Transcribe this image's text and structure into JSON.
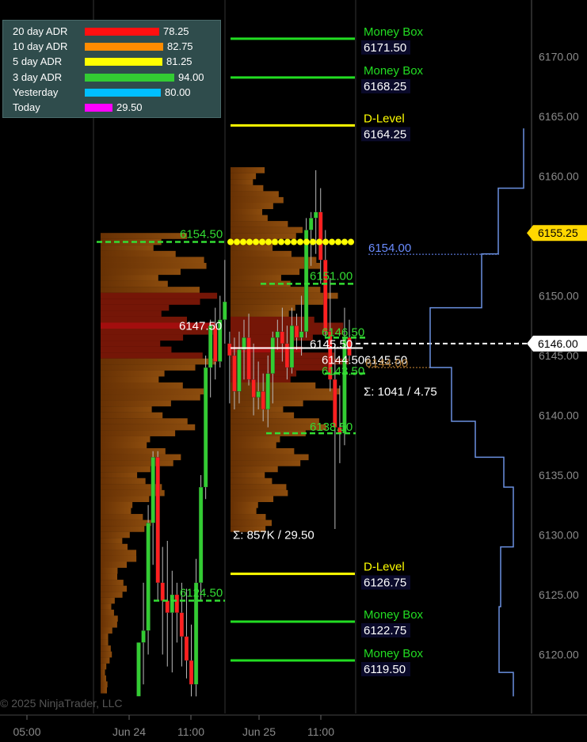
{
  "platform": {
    "copyright": "© 2025 NinjaTrader, LLC"
  },
  "adr_table": [
    {
      "label": "20 day ADR",
      "value": "78.25",
      "color": "#ff1010"
    },
    {
      "label": "10 day ADR",
      "value": "82.75",
      "color": "#ff8c00"
    },
    {
      "label": "5 day ADR",
      "value": "81.25",
      "color": "#ffff00"
    },
    {
      "label": "3 day ADR",
      "value": "94.00",
      "color": "#33cc33"
    },
    {
      "label": "Yesterday",
      "value": "80.00",
      "color": "#00bfff"
    },
    {
      "label": "Today",
      "value": "29.50",
      "color": "#ff00ff"
    }
  ],
  "chart_data": {
    "type": "candlestick",
    "y_axis": {
      "range": [
        6116.5,
        6175.0
      ],
      "ticks": [
        "6120.00",
        "6125.00",
        "6130.00",
        "6135.00",
        "6140.00",
        "6145.00",
        "6150.00",
        "6155.00",
        "6160.00",
        "6165.00",
        "6170.00"
      ]
    },
    "x_axis": {
      "ticks": [
        "05:00",
        "Jun 24",
        "11:00",
        "Jun 25",
        "11:00"
      ]
    },
    "current_price": {
      "label": "6155.25",
      "price": 6155.25,
      "color": "#ffd700"
    },
    "crosshair_price": {
      "label": "6146.00",
      "price": 6146.0
    },
    "levels": [
      {
        "name": "Money Box",
        "value": "6171.50",
        "price": 6171.5,
        "color": "#22dd22"
      },
      {
        "name": "Money Box",
        "value": "6168.25",
        "price": 6168.25,
        "color": "#22dd22"
      },
      {
        "name": "D-Level",
        "value": "6164.25",
        "price": 6164.25,
        "color": "#ffff00"
      },
      {
        "name": "D-Level",
        "value": "6126.75",
        "price": 6126.75,
        "color": "#ffff00"
      },
      {
        "name": "Money Box",
        "value": "6122.75",
        "price": 6122.75,
        "color": "#22dd22"
      },
      {
        "name": "Money Box",
        "value": "6119.50",
        "price": 6119.5,
        "color": "#22dd22"
      }
    ],
    "dashed_levels": [
      {
        "label": "6154.50",
        "price": 6154.5
      },
      {
        "label": "6151.00",
        "price": 6151.0
      },
      {
        "label": "6146.50",
        "price": 6146.5
      },
      {
        "label": "6143.50",
        "price": 6143.5
      },
      {
        "label": "6138.50",
        "price": 6138.5
      },
      {
        "label": "6124.50",
        "price": 6124.5
      }
    ],
    "annotations": [
      {
        "text": "6147.50",
        "price": 6147.5
      },
      {
        "text": "6145.50",
        "price": 6145.5
      },
      {
        "text": "6144.50",
        "price": 6144.5
      },
      {
        "text": "6145.50",
        "price": 6145.0
      },
      {
        "text": "6144.00",
        "price": 6144.25
      },
      {
        "text": "6154.00",
        "price": 6154.0
      },
      {
        "text": "Σ: 1041 / 4.75",
        "price": 6141.0
      },
      {
        "text": "Σ: 857K / 29.50",
        "price": 6130.0
      }
    ],
    "candles": [
      {
        "o": 6116.5,
        "h": 6121.0,
        "l": 6116.5,
        "c": 6121.0
      },
      {
        "o": 6121.0,
        "h": 6126.0,
        "l": 6117.5,
        "c": 6122.0
      },
      {
        "o": 6122.0,
        "h": 6132.5,
        "l": 6120.0,
        "c": 6131.0
      },
      {
        "o": 6131.0,
        "h": 6137.0,
        "l": 6127.5,
        "c": 6136.5
      },
      {
        "o": 6136.5,
        "h": 6137.0,
        "l": 6124.5,
        "c": 6126.0
      },
      {
        "o": 6126.0,
        "h": 6129.0,
        "l": 6120.0,
        "c": 6124.5
      },
      {
        "o": 6124.5,
        "h": 6129.5,
        "l": 6119.0,
        "c": 6123.5
      },
      {
        "o": 6123.5,
        "h": 6127.0,
        "l": 6118.5,
        "c": 6125.0
      },
      {
        "o": 6125.0,
        "h": 6126.0,
        "l": 6121.0,
        "c": 6123.5
      },
      {
        "o": 6123.5,
        "h": 6126.0,
        "l": 6119.0,
        "c": 6121.5
      },
      {
        "o": 6121.5,
        "h": 6125.5,
        "l": 6118.0,
        "c": 6119.5
      },
      {
        "o": 6119.5,
        "h": 6122.5,
        "l": 6116.5,
        "c": 6117.5
      },
      {
        "o": 6117.5,
        "h": 6128.0,
        "l": 6116.5,
        "c": 6126.0
      },
      {
        "o": 6126.0,
        "h": 6135.0,
        "l": 6124.5,
        "c": 6134.0
      },
      {
        "o": 6134.0,
        "h": 6145.0,
        "l": 6133.0,
        "c": 6144.0
      },
      {
        "o": 6144.0,
        "h": 6148.0,
        "l": 6141.5,
        "c": 6147.5
      },
      {
        "o": 6147.5,
        "h": 6149.0,
        "l": 6143.0,
        "c": 6144.5
      },
      {
        "o": 6144.5,
        "h": 6150.0,
        "l": 6144.0,
        "c": 6148.0
      },
      {
        "o": 6148.0,
        "h": 6153.0,
        "l": 6146.0,
        "c": 6149.5
      },
      {
        "o": 6146.0,
        "h": 6147.0,
        "l": 6141.0,
        "c": 6145.0
      },
      {
        "o": 6145.0,
        "h": 6146.5,
        "l": 6140.5,
        "c": 6142.0
      },
      {
        "o": 6142.0,
        "h": 6147.0,
        "l": 6141.0,
        "c": 6145.5
      },
      {
        "o": 6145.5,
        "h": 6148.0,
        "l": 6143.0,
        "c": 6146.5
      },
      {
        "o": 6146.5,
        "h": 6148.5,
        "l": 6142.5,
        "c": 6143.0
      },
      {
        "o": 6143.0,
        "h": 6146.0,
        "l": 6140.0,
        "c": 6141.5
      },
      {
        "o": 6141.5,
        "h": 6144.5,
        "l": 6140.5,
        "c": 6142.0
      },
      {
        "o": 6142.0,
        "h": 6143.5,
        "l": 6139.5,
        "c": 6140.5
      },
      {
        "o": 6140.5,
        "h": 6145.0,
        "l": 6139.0,
        "c": 6143.5
      },
      {
        "o": 6143.5,
        "h": 6147.0,
        "l": 6141.0,
        "c": 6146.5
      },
      {
        "o": 6146.5,
        "h": 6148.0,
        "l": 6145.5,
        "c": 6147.0
      },
      {
        "o": 6147.0,
        "h": 6149.0,
        "l": 6144.5,
        "c": 6146.0
      },
      {
        "o": 6146.0,
        "h": 6147.5,
        "l": 6143.0,
        "c": 6144.0
      },
      {
        "o": 6144.0,
        "h": 6149.0,
        "l": 6143.5,
        "c": 6147.5
      },
      {
        "o": 6147.5,
        "h": 6148.5,
        "l": 6145.5,
        "c": 6146.5
      },
      {
        "o": 6146.5,
        "h": 6150.0,
        "l": 6145.0,
        "c": 6147.0
      },
      {
        "o": 6147.0,
        "h": 6156.5,
        "l": 6146.5,
        "c": 6155.5
      },
      {
        "o": 6155.5,
        "h": 6157.0,
        "l": 6152.5,
        "c": 6156.5
      },
      {
        "o": 6156.5,
        "h": 6160.5,
        "l": 6153.5,
        "c": 6157.0
      },
      {
        "o": 6157.0,
        "h": 6159.0,
        "l": 6151.0,
        "c": 6153.0
      },
      {
        "o": 6153.0,
        "h": 6155.5,
        "l": 6146.5,
        "c": 6147.0
      },
      {
        "o": 6147.0,
        "h": 6151.5,
        "l": 6142.0,
        "c": 6143.0
      },
      {
        "o": 6143.0,
        "h": 6146.0,
        "l": 6130.5,
        "c": 6139.0
      },
      {
        "o": 6139.0,
        "h": 6142.5,
        "l": 6136.0,
        "c": 6138.5
      },
      {
        "o": 6138.5,
        "h": 6149.0,
        "l": 6137.5,
        "c": 6146.5
      },
      {
        "o": 6146.5,
        "h": 6148.0,
        "l": 6144.5,
        "c": 6145.0
      }
    ]
  }
}
